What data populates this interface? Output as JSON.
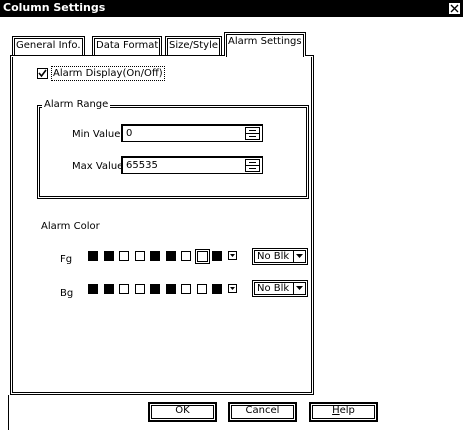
{
  "window": {
    "title": "Column Settings",
    "close_glyph": "X"
  },
  "tabs": [
    {
      "label": "General Info.",
      "active": false
    },
    {
      "label": "Data Format",
      "active": false
    },
    {
      "label": "Size/Style",
      "active": false
    },
    {
      "label": "Alarm Settings",
      "active": true
    }
  ],
  "alarm_display": {
    "label": "Alarm Display(On/Off)",
    "checked": true
  },
  "alarm_range": {
    "title": "Alarm Range",
    "min_label": "Min Value",
    "min_value": "0",
    "max_label": "Max Value",
    "max_value": "65535"
  },
  "alarm_color": {
    "title": "Alarm Color",
    "fg_label": "Fg",
    "bg_label": "Bg",
    "fg_swatches": [
      "black",
      "black",
      "white",
      "white",
      "black",
      "black",
      "white",
      "white",
      "black"
    ],
    "fg_selected_index": 7,
    "bg_swatches": [
      "black",
      "black",
      "white",
      "white",
      "black",
      "black",
      "white",
      "white",
      "black"
    ],
    "fg_option": "No Blk",
    "bg_option": "No Blk"
  },
  "buttons": {
    "ok": "OK",
    "cancel": "Cancel",
    "help_first": "H",
    "help_rest": "elp"
  }
}
